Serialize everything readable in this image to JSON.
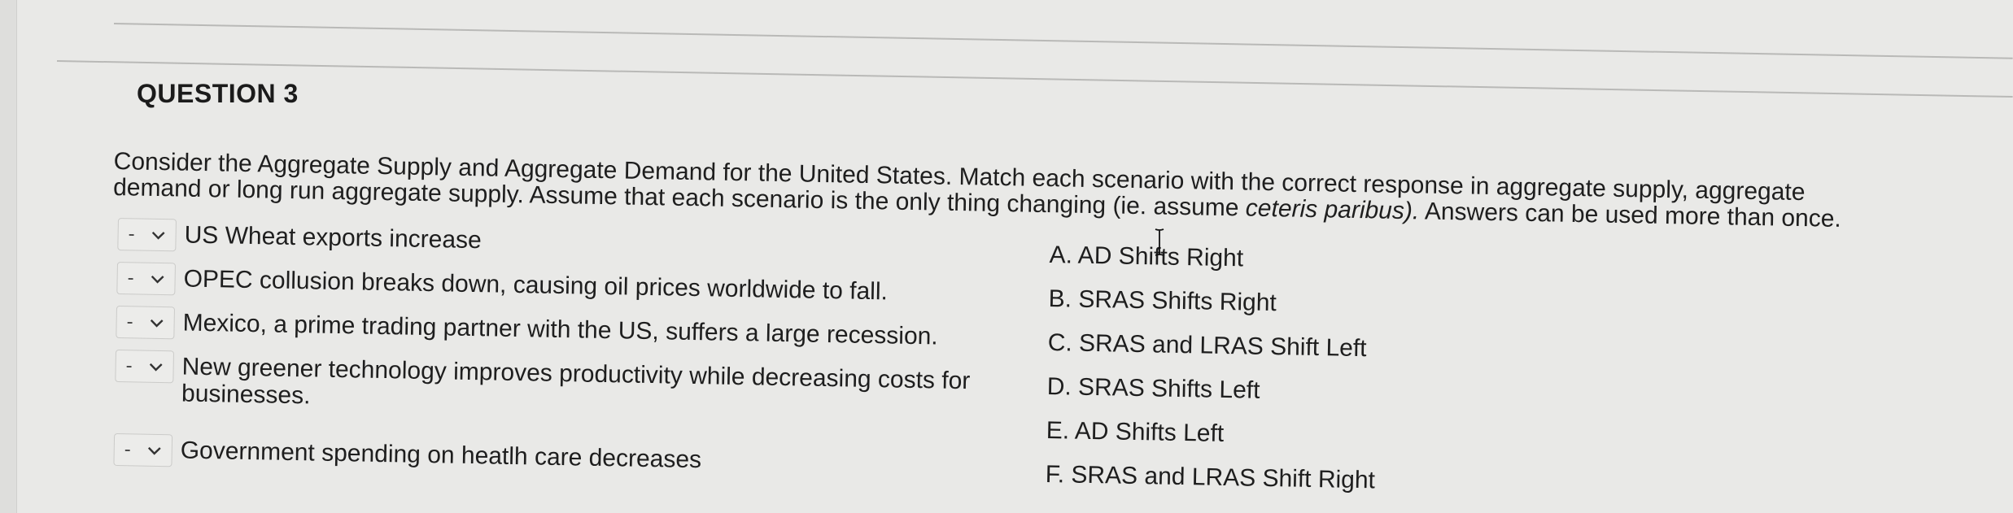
{
  "question": {
    "title": "QUESTION 3",
    "prompt_line1": "Consider the Aggregate Supply and Aggregate Demand for the United States.  Match each scenario with the correct response in aggregate supply, aggregate",
    "prompt_line2a": "demand or long run aggregate supply.  Assume that each scenario is the only thing changing (ie. assume ",
    "prompt_line2b": "ceteris paribus).",
    "prompt_line2c": " Answers can be used more than once."
  },
  "scenarios": [
    {
      "selected": "-",
      "text": "US Wheat exports increase"
    },
    {
      "selected": "-",
      "text": "OPEC collusion breaks down, causing oil prices worldwide to fall."
    },
    {
      "selected": "-",
      "text": "Mexico, a prime trading partner with the US, suffers a large recession."
    },
    {
      "selected": "-",
      "text": "New greener technology improves productivity while decreasing costs for businesses."
    },
    {
      "selected": "-",
      "text": "Government spending on heatlh care decreases"
    }
  ],
  "answers": [
    "A. AD Shifts Right",
    "B. SRAS Shifts Right",
    "C. SRAS and LRAS Shift Left",
    "D. SRAS Shifts Left",
    "E. AD Shifts Left",
    "F. SRAS and LRAS Shift Right"
  ],
  "icons": {
    "dropdown": "chevron-down-icon",
    "cursor": "text-cursor-icon"
  }
}
